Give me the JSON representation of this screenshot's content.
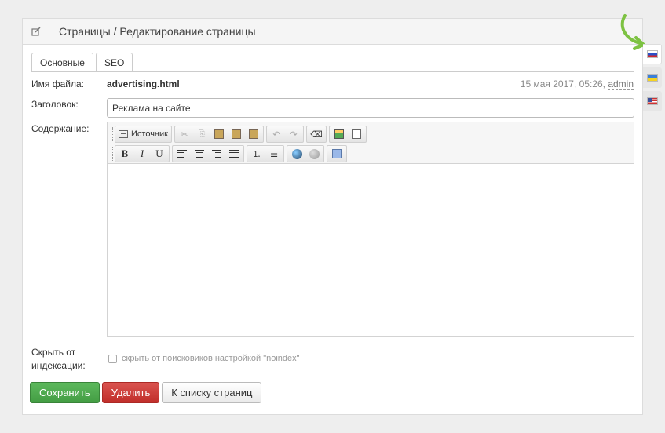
{
  "header": {
    "icon": "edit-icon",
    "breadcrumb": "Страницы / Редактирование страницы"
  },
  "tabs": [
    {
      "label": "Основные",
      "active": true
    },
    {
      "label": "SEO",
      "active": false
    }
  ],
  "form": {
    "filename_label": "Имя файла:",
    "filename_value": "advertising.html",
    "meta_date": "15 мая 2017, 05:26,",
    "meta_author": "admin",
    "title_label": "Заголовок:",
    "title_value": "Реклама на сайте",
    "content_label": "Содержание:",
    "hide_label_line1": "Скрыть от",
    "hide_label_line2": "индексации:",
    "noindex_text": "скрыть от поисковиков настройкой \"noindex\""
  },
  "editor": {
    "source_label": "Источник",
    "content": ""
  },
  "actions": {
    "save": "Сохранить",
    "delete": "Удалить",
    "back": "К списку страниц"
  },
  "languages": [
    {
      "code": "ru",
      "icon": "russia-flag-icon",
      "active": true
    },
    {
      "code": "ua",
      "icon": "ukraine-flag-icon",
      "active": false
    },
    {
      "code": "us",
      "icon": "usa-flag-icon",
      "active": false
    }
  ],
  "colors": {
    "save": "#5cb85c",
    "delete": "#d9534f",
    "arrow": "#7dc242"
  }
}
